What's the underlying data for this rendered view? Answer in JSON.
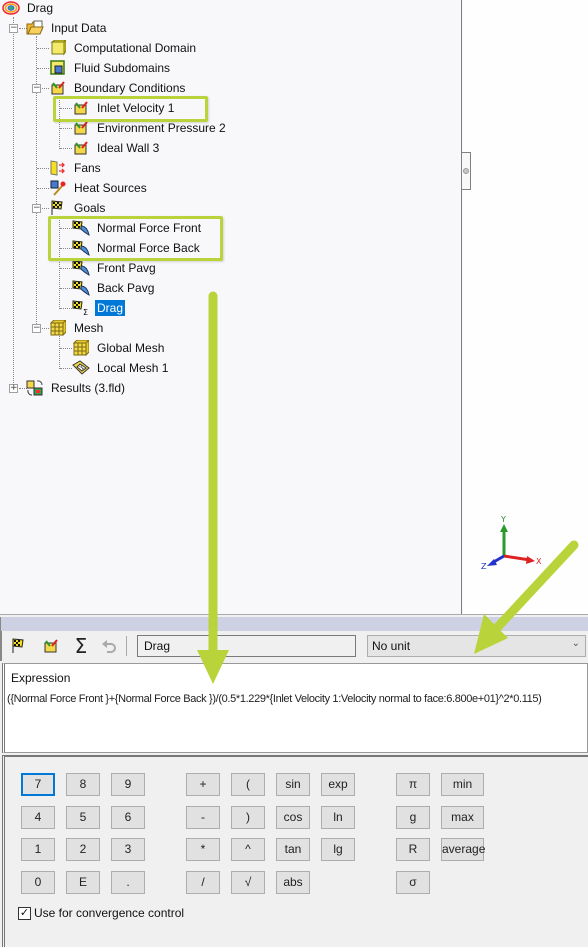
{
  "tree": {
    "root": {
      "label": "Drag",
      "icon": "project-icon"
    },
    "items": [
      {
        "label": "Input Data",
        "icon": "input-data-folder-icon",
        "level": 1,
        "expanded": true
      },
      {
        "label": "Computational Domain",
        "icon": "computational-domain-icon",
        "level": 2
      },
      {
        "label": "Fluid Subdomains",
        "icon": "fluid-subdomains-icon",
        "level": 2
      },
      {
        "label": "Boundary Conditions",
        "icon": "boundary-conditions-icon",
        "level": 2,
        "expanded": true
      },
      {
        "label": "Inlet Velocity 1",
        "icon": "boundary-condition-icon",
        "level": 3,
        "highlighted": true
      },
      {
        "label": "Environment Pressure 2",
        "icon": "boundary-condition-icon",
        "level": 3
      },
      {
        "label": "Ideal Wall 3",
        "icon": "boundary-condition-icon",
        "level": 3
      },
      {
        "label": "Fans",
        "icon": "fans-icon",
        "level": 2
      },
      {
        "label": "Heat Sources",
        "icon": "heat-sources-icon",
        "level": 2
      },
      {
        "label": "Goals",
        "icon": "goals-flag-icon",
        "level": 2,
        "expanded": true
      },
      {
        "label": "Normal Force Front",
        "icon": "surface-goal-icon",
        "level": 3,
        "highlighted": true
      },
      {
        "label": "Normal Force Back",
        "icon": "surface-goal-icon",
        "level": 3,
        "highlighted": true
      },
      {
        "label": "Front Pavg",
        "icon": "surface-goal-icon",
        "level": 3
      },
      {
        "label": "Back Pavg",
        "icon": "surface-goal-icon",
        "level": 3
      },
      {
        "label": "Drag",
        "icon": "equation-goal-icon",
        "level": 3,
        "selected": true
      },
      {
        "label": "Mesh",
        "icon": "mesh-icon",
        "level": 2,
        "expanded": true
      },
      {
        "label": "Global Mesh",
        "icon": "global-mesh-icon",
        "level": 3
      },
      {
        "label": "Local Mesh 1",
        "icon": "local-mesh-icon",
        "level": 3
      },
      {
        "label": "Results (3.fld)",
        "icon": "results-icon",
        "level": 1,
        "expanded": false
      }
    ]
  },
  "triad": {
    "x": "X",
    "y": "Y",
    "z": "Z"
  },
  "editor": {
    "goal_name": "Drag",
    "unit": "No unit",
    "expression_label": "Expression",
    "expression": "({Normal Force Front }+{Normal Force Back })/(0.5*1.229*{Inlet Velocity 1:Velocity normal to face:6.800e+01}^2*0.115)",
    "keys": {
      "digits": [
        [
          "7",
          "8",
          "9"
        ],
        [
          "4",
          "5",
          "6"
        ],
        [
          "1",
          "2",
          "3"
        ],
        [
          "0",
          "E",
          "."
        ]
      ],
      "operators": [
        [
          "+",
          "("
        ],
        [
          "-",
          ")"
        ],
        [
          "*",
          "^"
        ],
        [
          "/",
          "√"
        ]
      ],
      "functions": [
        [
          "sin",
          "exp"
        ],
        [
          "cos",
          "ln"
        ],
        [
          "tan",
          "lg"
        ],
        [
          "abs"
        ]
      ],
      "constants": [
        "π",
        "g",
        "R",
        "σ"
      ],
      "aggregates": [
        "min",
        "max",
        "average"
      ]
    },
    "convergence": {
      "label": "Use for convergence control",
      "checked": true
    }
  },
  "colors": {
    "highlight": "#b8d43a",
    "selection": "#0078d7"
  }
}
